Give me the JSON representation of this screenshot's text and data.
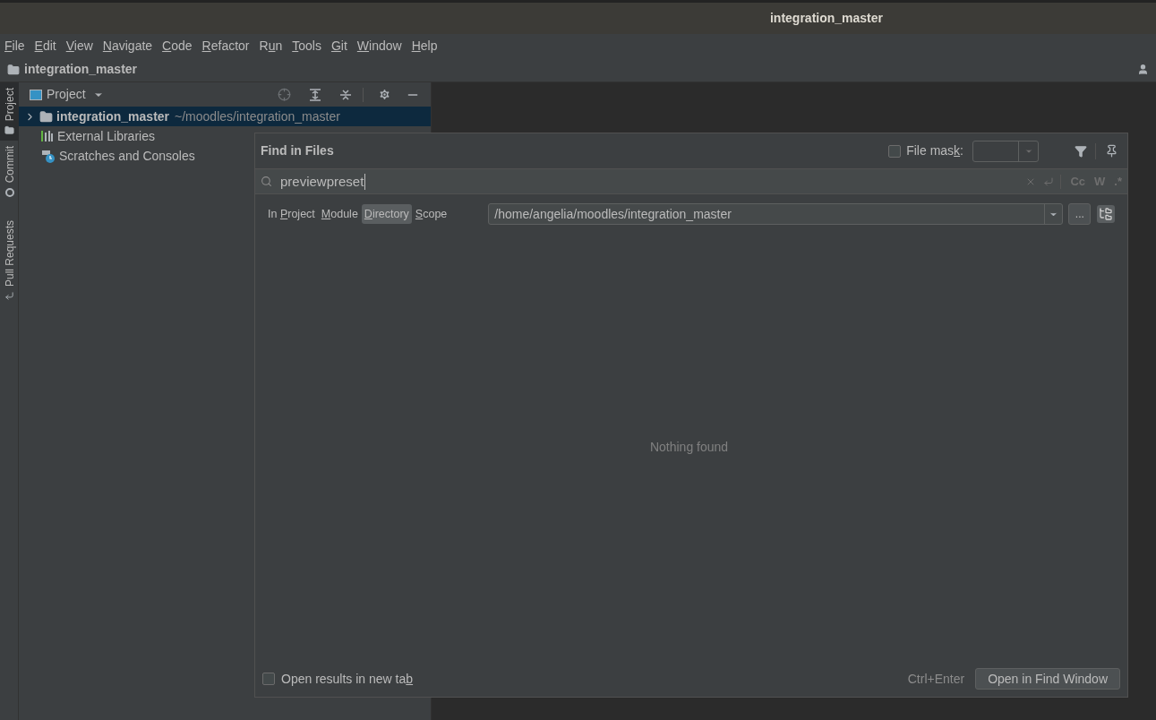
{
  "window": {
    "title": "integration_master"
  },
  "menu": [
    {
      "key": "F",
      "post": "ile"
    },
    {
      "key": "E",
      "post": "dit"
    },
    {
      "key": "V",
      "post": "iew"
    },
    {
      "key": "N",
      "post": "avigate"
    },
    {
      "key": "C",
      "post": "ode"
    },
    {
      "key": "R",
      "post": "efactor"
    },
    {
      "pre": "R",
      "key": "u",
      "post": "n"
    },
    {
      "key": "T",
      "post": "ools"
    },
    {
      "key": "G",
      "post": "it"
    },
    {
      "key": "W",
      "post": "indow"
    },
    {
      "key": "H",
      "post": "elp"
    }
  ],
  "breadcrumb": "integration_master",
  "side_tabs": [
    {
      "label": "Project",
      "kind": "project",
      "selected": true
    },
    {
      "label": "Commit",
      "kind": "commit",
      "selected": false
    },
    {
      "label": "Pull Requests",
      "kind": "pull",
      "selected": false
    }
  ],
  "project_panel": {
    "title": "Project",
    "tree": [
      {
        "name": "integration_master",
        "path": "~/moodles/integration_master",
        "kind": "folder",
        "selected": true,
        "expanded": false
      },
      {
        "name": "External Libraries",
        "kind": "libraries",
        "selected": false
      },
      {
        "name": "Scratches and Consoles",
        "kind": "scratches",
        "selected": false
      }
    ]
  },
  "find_dialog": {
    "title": "Find in Files",
    "file_mask": {
      "label": {
        "pre": "File mas",
        "key": "k",
        "post": ":"
      },
      "checked": false
    },
    "query": "previewpreset",
    "search_toggles": [
      "Cc",
      "W",
      ".*"
    ],
    "scopes": [
      {
        "label": {
          "pre": "In ",
          "key": "P",
          "post": "roject"
        },
        "selected": false
      },
      {
        "label": {
          "key": "M",
          "post": "odule"
        },
        "selected": false
      },
      {
        "label": {
          "key": "D",
          "post": "irectory"
        },
        "selected": true
      },
      {
        "label": {
          "key": "S",
          "post": "cope"
        },
        "selected": false
      }
    ],
    "directory": "/home/angelia/moodles/integration_master",
    "browse_button": "...",
    "empty_text": "Nothing found",
    "new_tab": {
      "label": {
        "pre": "Open results in new ta",
        "key": "b"
      },
      "checked": false
    },
    "shortcut": "Ctrl+Enter",
    "open_button": "Open in Find Window"
  }
}
